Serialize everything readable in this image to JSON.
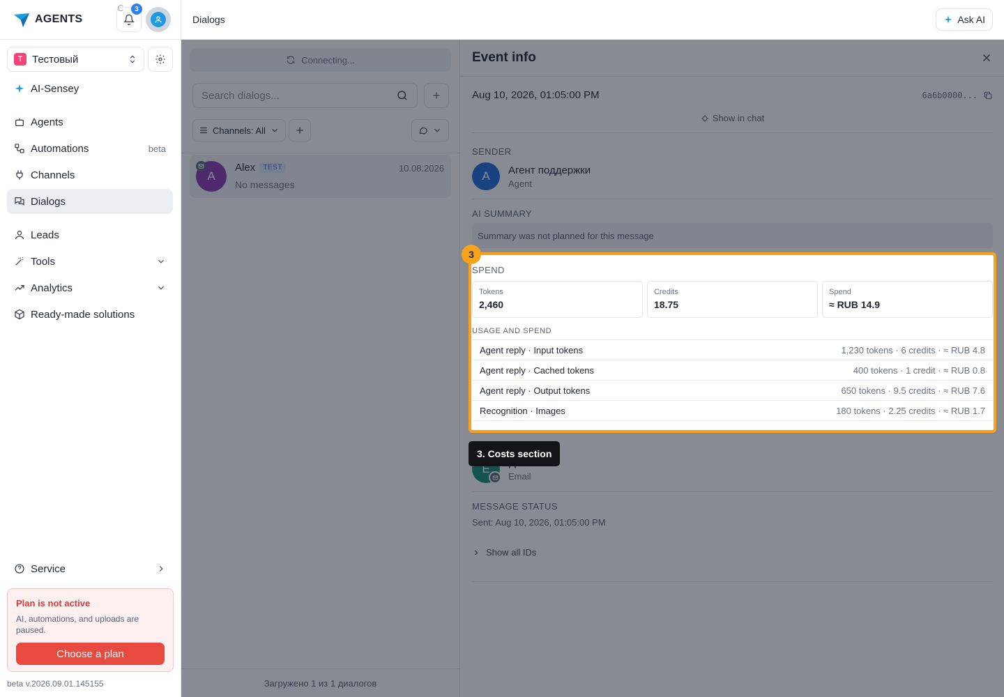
{
  "app": {
    "logo_text": "AGENTS",
    "notifications_count": "3",
    "version": "beta v.2026.09.01.145155"
  },
  "workspace": {
    "letter": "T",
    "name": "Тестовый"
  },
  "sidebar": {
    "ai_item": "AI-Sensey",
    "items": [
      {
        "label": "Agents"
      },
      {
        "label": "Automations",
        "badge": "beta"
      },
      {
        "label": "Channels"
      },
      {
        "label": "Dialogs"
      },
      {
        "label": "Leads"
      },
      {
        "label": "Tools"
      },
      {
        "label": "Analytics"
      },
      {
        "label": "Ready-made solutions"
      }
    ],
    "service": "Service"
  },
  "plan": {
    "title": "Plan is not active",
    "text": "AI, automations, and uploads are paused.",
    "button": "Choose a plan"
  },
  "topbar": {
    "breadcrumb": "Dialogs",
    "ask_ai": "Ask AI"
  },
  "dialogs": {
    "connecting": "Connecting...",
    "search_placeholder": "Search dialogs...",
    "channels_filter": "Channels: All",
    "list": [
      {
        "avatar": "A",
        "name": "Alex",
        "badge": "TEST",
        "date": "10.08.2026",
        "preview": "No messages"
      }
    ],
    "footer": "Загружено 1 из 1 диалогов"
  },
  "event": {
    "title": "Event info",
    "time": "Aug 10, 2026, 01:05:00 PM",
    "id": "6a6b0000...",
    "show_in_chat": "Show in chat",
    "sender_label": "SENDER",
    "sender": {
      "avatar": "A",
      "name": "Агент поддержки",
      "role": "Agent"
    },
    "summary_label": "AI SUMMARY",
    "summary_text": "Summary was not planned for this message",
    "spend_label": "SPEND",
    "stats": [
      {
        "label": "Tokens",
        "value": "2,460"
      },
      {
        "label": "Credits",
        "value": "18.75"
      },
      {
        "label": "Spend",
        "value": "≈ RUB 14.9"
      }
    ],
    "usage_label": "USAGE AND SPEND",
    "usage": [
      {
        "name": "Agent reply · Input tokens",
        "value": "1,230 tokens · 6 credits · ≈ RUB 4.8"
      },
      {
        "name": "Agent reply · Cached tokens",
        "value": "400 tokens · 1 credit · ≈ RUB 0.8"
      },
      {
        "name": "Agent reply · Output tokens",
        "value": "650 tokens · 9.5 credits · ≈ RUB 7.6"
      },
      {
        "name": "Recognition · Images",
        "value": "180 tokens · 2.25 credits · ≈ RUB 1.7"
      }
    ],
    "recipient": {
      "avatar": "E",
      "name_visible": "pport",
      "role": "Email"
    },
    "status_label": "MESSAGE STATUS",
    "status_text": "Sent: Aug 10, 2026, 01:05:00 PM",
    "show_ids": "Show all IDs"
  },
  "overlay": {
    "step_number": "3",
    "tooltip": "3. Costs section",
    "accent_color": "#f6a21a"
  }
}
